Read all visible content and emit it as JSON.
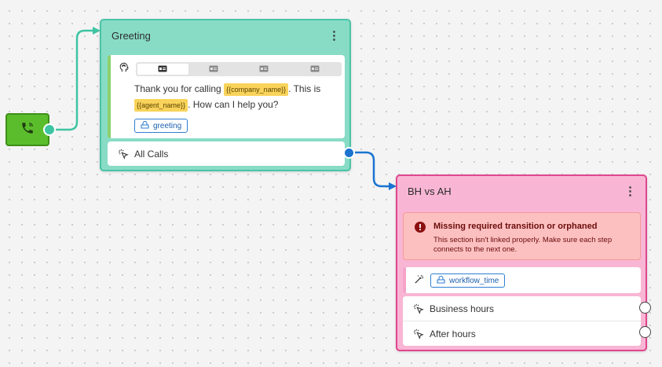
{
  "colors": {
    "greeting_header": "#88dcc6",
    "greeting_border": "#4ac3a7",
    "bhah_header": "#f8b6d4",
    "bhah_border": "#e0468f",
    "start_node": "#5bbd2b",
    "edge_green": "#3ec4a2",
    "edge_blue": "#1a73d1",
    "error_bg": "#fdc0c0",
    "variable_bg": "#f9d35a"
  },
  "start_node": {
    "icon": "phone-icon"
  },
  "greeting_node": {
    "title": "Greeting",
    "menu_icon": "kebab-menu-icon",
    "message": {
      "icon": "speech-head-icon",
      "tabs": [
        "tab-1",
        "tab-2",
        "tab-3",
        "tab-4"
      ],
      "active_tab": 0,
      "text_1": "Thank you for calling",
      "var_1": "{{company_name}}",
      "text_2": ". This is",
      "var_2": "{{agent_name}}",
      "text_3": ". How can I help you?",
      "tag_label": "greeting"
    },
    "route": {
      "label": "All Calls",
      "icon": "pointer-click-icon"
    }
  },
  "bhah_node": {
    "title": "BH vs AH",
    "menu_icon": "kebab-menu-icon",
    "error": {
      "icon": "error-icon",
      "title": "Missing required transition or orphaned",
      "body": "This section isn't linked properly. Make sure each step connects to the next one."
    },
    "tool": {
      "icon": "wand-icon",
      "tag_label": "workflow_time"
    },
    "routes": [
      {
        "label": "Business hours",
        "icon": "pointer-click-icon"
      },
      {
        "label": "After hours",
        "icon": "pointer-click-icon"
      }
    ]
  }
}
